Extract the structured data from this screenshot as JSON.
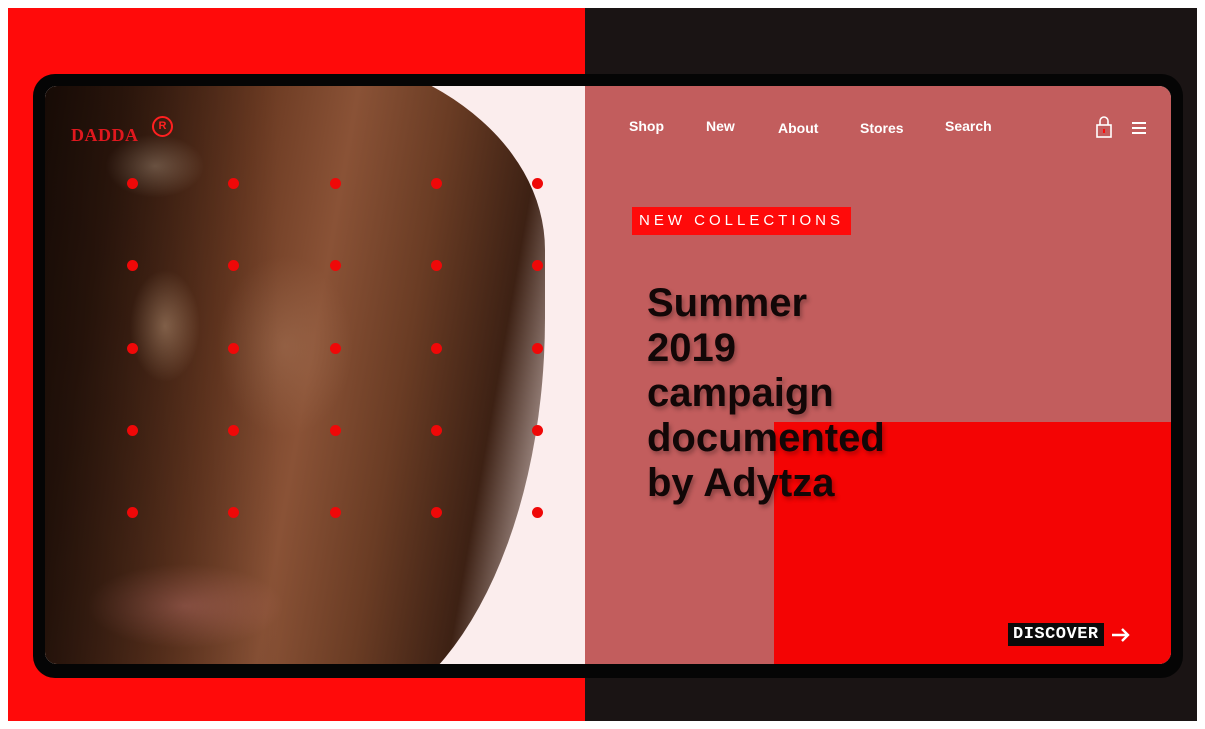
{
  "brand": {
    "name": "DADDA",
    "mark": "R"
  },
  "nav": {
    "items": [
      "Shop",
      "New",
      "About",
      "Stores",
      "Search"
    ]
  },
  "icons": {
    "cart": "shopping-bag-icon",
    "menu": "hamburger-menu-icon",
    "arrow": "arrow-right-icon"
  },
  "hero": {
    "tag": "NEW COLLECTIONS",
    "headline_lines": [
      "Summer",
      "2019",
      "campaign",
      "documented",
      "by Adytza"
    ],
    "cta": "DISCOVER"
  },
  "colors": {
    "accent": "#ff0a0a",
    "panel": "#c25d5d",
    "dark": "#1a1414",
    "text": "#120707"
  }
}
